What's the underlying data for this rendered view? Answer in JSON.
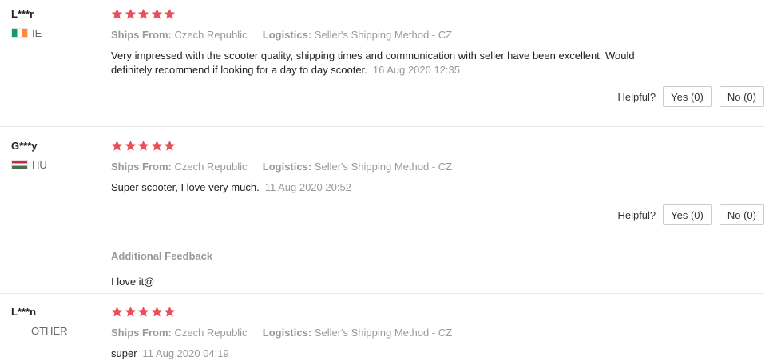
{
  "colors": {
    "star": "#e8505b",
    "muted": "#999999",
    "text": "#222222",
    "divider": "#e8e8e8"
  },
  "helpful_label": "Helpful?",
  "labels": {
    "ships_from": "Ships From:",
    "logistics": "Logistics:"
  },
  "reviews": [
    {
      "user": "L***r",
      "country_code": "IE",
      "flag": "ireland-flag-icon",
      "rating": 5,
      "ships_from": "Czech Republic",
      "logistics": "Seller's Shipping Method - CZ",
      "text": "Very impressed with the scooter quality, shipping times and communication with seller have been excellent. Would definitely recommend if looking for a day to day scooter.",
      "date": "16 Aug 2020 12:35",
      "yes_label": "Yes (0)",
      "no_label": "No (0)"
    },
    {
      "user": "G***y",
      "country_code": "HU",
      "flag": "hungary-flag-icon",
      "rating": 5,
      "ships_from": "Czech Republic",
      "logistics": "Seller's Shipping Method - CZ",
      "text": "Super scooter, I love very much.",
      "date": "11 Aug 2020 20:52",
      "yes_label": "Yes (0)",
      "no_label": "No (0)",
      "additional_feedback": {
        "title": "Additional Feedback",
        "text": "I love it@"
      }
    },
    {
      "user": "L***n",
      "country_code": "OTHER",
      "rating": 5,
      "ships_from": "Czech Republic",
      "logistics": "Seller's Shipping Method - CZ",
      "text": "super",
      "date": "11 Aug 2020 04:19"
    }
  ]
}
